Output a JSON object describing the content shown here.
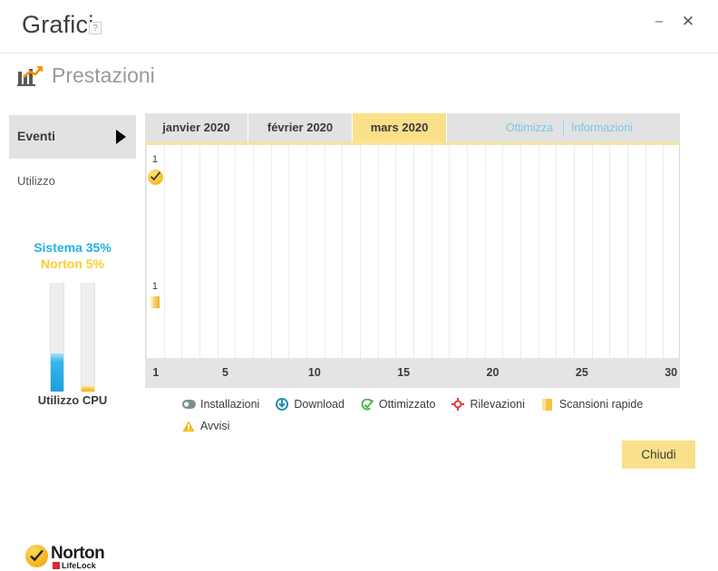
{
  "window": {
    "title": "Grafici",
    "help_badge": "?",
    "minimize_icon": "minimize-icon",
    "close_icon": "close-icon"
  },
  "section": {
    "title": "Prestazioni",
    "icon": "performance-chart-icon"
  },
  "sidebar": {
    "items": [
      {
        "label": "Eventi",
        "active": true,
        "arrow_icon": "play-arrow-icon"
      },
      {
        "label": "Utilizzo",
        "active": false
      }
    ],
    "cpu_widget": {
      "system_label": "Sistema 35%",
      "norton_label": "Norton 5%",
      "caption": "Utilizzo CPU",
      "system_percent": 35,
      "norton_percent": 5,
      "system_color": "#22b0ea",
      "norton_color": "#ffcc33"
    },
    "brand": {
      "name": "Norton",
      "sub": "LifeLock",
      "check_icon": "norton-check-icon"
    }
  },
  "chart_panel": {
    "tabs": [
      {
        "label": "janvier 2020",
        "active": false
      },
      {
        "label": "février 2020",
        "active": false
      },
      {
        "label": "mars 2020",
        "active": true
      }
    ],
    "links": [
      {
        "label": "Ottimizza"
      },
      {
        "label": "Informazioni"
      }
    ],
    "active_tab_color": "#fbe08b"
  },
  "chart_data": {
    "type": "scatter",
    "title": "mars 2020",
    "xlabel": "",
    "ylabel": "",
    "x_ticks": [
      1,
      5,
      10,
      15,
      20,
      25,
      30
    ],
    "xlim": [
      1,
      31
    ],
    "grid": true,
    "legend_position": "bottom",
    "series": [
      {
        "name": "Installazioni",
        "icon": "pill-icon",
        "color": "#7a8f92",
        "points": []
      },
      {
        "name": "Download",
        "icon": "download-icon",
        "color": "#1e8fae",
        "points": []
      },
      {
        "name": "Ottimizzato",
        "icon": "optimize-icon",
        "color": "#4fb84f",
        "points": [
          {
            "x": 1,
            "count": 1,
            "label": "1"
          }
        ]
      },
      {
        "name": "Rilevazioni",
        "icon": "target-icon",
        "color": "#e23b3b",
        "points": []
      },
      {
        "name": "Scansioni rapide",
        "icon": "scan-bar-icon",
        "color": "#f0b429",
        "points": [
          {
            "x": 1,
            "count": 1,
            "label": "1"
          }
        ]
      },
      {
        "name": "Avvisi",
        "icon": "warning-icon",
        "color": "#f0b429",
        "points": []
      }
    ]
  },
  "footer": {
    "close_button": "Chiudi"
  }
}
